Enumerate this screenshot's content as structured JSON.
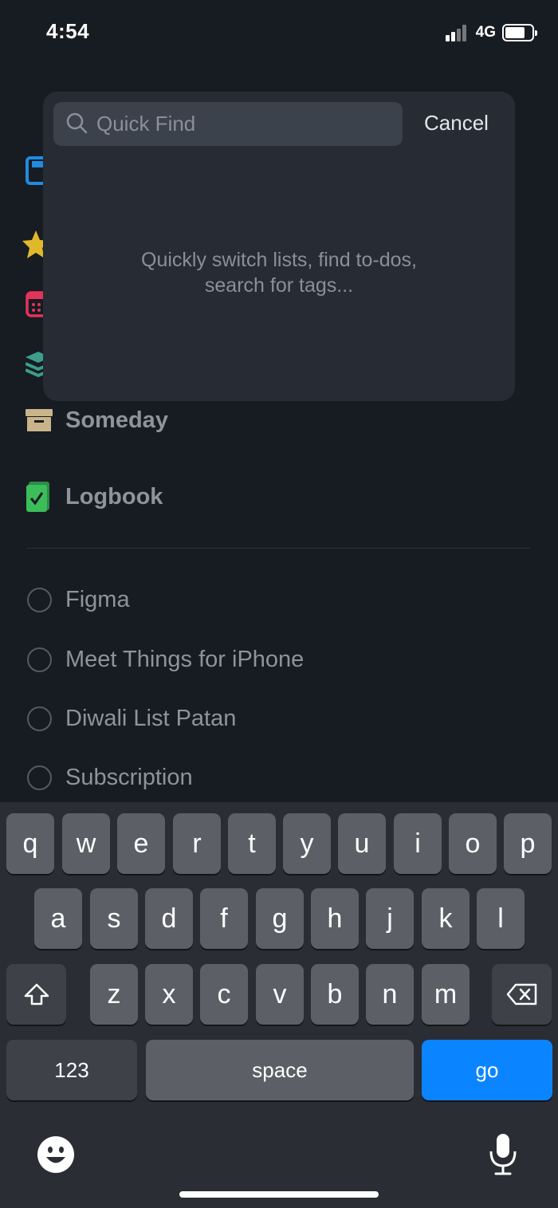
{
  "status_bar": {
    "time": "4:54",
    "network": "4G"
  },
  "areas": [
    {
      "label": "Someday"
    },
    {
      "label": "Logbook"
    }
  ],
  "projects": [
    {
      "label": "Figma"
    },
    {
      "label": "Meet Things for iPhone"
    },
    {
      "label": "Diwali List Patan"
    },
    {
      "label": "Subscription"
    }
  ],
  "quick_find": {
    "placeholder": "Quick Find",
    "cancel_label": "Cancel",
    "hint_line1": "Quickly switch lists, find to-dos,",
    "hint_line2": "search for tags..."
  },
  "keyboard": {
    "row1": [
      "q",
      "w",
      "e",
      "r",
      "t",
      "y",
      "u",
      "i",
      "o",
      "p"
    ],
    "row2": [
      "a",
      "s",
      "d",
      "f",
      "g",
      "h",
      "j",
      "k",
      "l"
    ],
    "row3": [
      "z",
      "x",
      "c",
      "v",
      "b",
      "n",
      "m"
    ],
    "numbers_label": "123",
    "space_label": "space",
    "go_label": "go"
  },
  "colors": {
    "background": "#171b22",
    "panel": "#262b34",
    "accent_go": "#0b84ff",
    "inbox_blue": "#1f8ce0",
    "today_star": "#e0b82b",
    "upcoming_red": "#e6335a",
    "anytime_teal": "#3c9d8a",
    "someday_tan": "#c9b48a",
    "logbook_green": "#3bbd5a"
  }
}
